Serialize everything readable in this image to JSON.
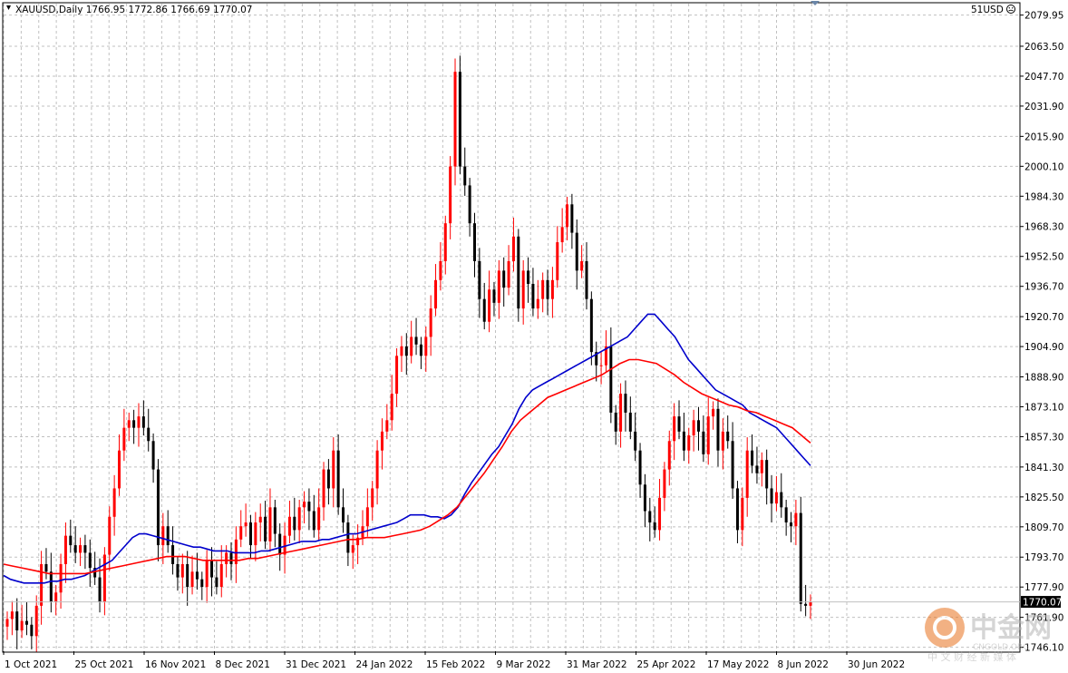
{
  "header": {
    "symbol_info": "XAUUSD,Daily  1766.95 1772.86 1766.69 1770.07",
    "account_label": "51USD"
  },
  "price_marker": {
    "value": "1770.07",
    "color": "#000000"
  },
  "watermark": {
    "brand": "中金网",
    "domain": "CNGOLD.ORG",
    "tagline": "中 文 财 经 新 媒 体"
  },
  "colors": {
    "bull": "#ff0000",
    "bear": "#000000",
    "ma_fast": "#0000cc",
    "ma_slow": "#ff0000",
    "grid": "#c0c0c0"
  },
  "chart_data": {
    "type": "candlestick",
    "title": "XAUUSD,Daily",
    "y_axis": {
      "range": [
        1744,
        2086
      ],
      "ticks": [
        "2079.95",
        "2063.50",
        "2047.70",
        "2031.90",
        "2015.90",
        "2000.10",
        "1984.30",
        "1968.30",
        "1952.50",
        "1936.70",
        "1920.70",
        "1904.90",
        "1888.90",
        "1873.10",
        "1857.30",
        "1841.30",
        "1825.50",
        "1809.70",
        "1793.70",
        "1777.90",
        "1761.90",
        "1746.10"
      ]
    },
    "x_axis": {
      "ticks": [
        "1 Oct 2021",
        "25 Oct 2021",
        "16 Nov 2021",
        "8 Dec 2021",
        "31 Dec 2021",
        "24 Jan 2022",
        "15 Feb 2022",
        "9 Mar 2022",
        "31 Mar 2022",
        "25 Apr 2022",
        "17 May 2022",
        "8 Jun 2022",
        "30 Jun 2022"
      ]
    },
    "grid": true,
    "last_price": 1770.07,
    "closes": [
      1761,
      1765,
      1755,
      1760,
      1758,
      1752,
      1768,
      1790,
      1786,
      1770,
      1775,
      1790,
      1805,
      1800,
      1796,
      1800,
      1796,
      1788,
      1783,
      1770,
      1795,
      1815,
      1830,
      1850,
      1862,
      1866,
      1862,
      1868,
      1862,
      1855,
      1840,
      1800,
      1810,
      1800,
      1790,
      1783,
      1790,
      1778,
      1786,
      1782,
      1778,
      1792,
      1783,
      1778,
      1790,
      1796,
      1790,
      1803,
      1810,
      1812,
      1800,
      1812,
      1815,
      1802,
      1820,
      1806,
      1795,
      1805,
      1815,
      1808,
      1820,
      1823,
      1818,
      1808,
      1820,
      1840,
      1830,
      1850,
      1820,
      1812,
      1796,
      1800,
      1804,
      1810,
      1820,
      1830,
      1850,
      1860,
      1866,
      1880,
      1900,
      1905,
      1900,
      1910,
      1906,
      1900,
      1910,
      1925,
      1940,
      1950,
      1970,
      2000,
      2050,
      2000,
      1990,
      1970,
      1950,
      1930,
      1918,
      1935,
      1928,
      1945,
      1936,
      1950,
      1963,
      1925,
      1945,
      1938,
      1925,
      1930,
      1940,
      1930,
      1940,
      1960,
      1968,
      1980,
      1965,
      1945,
      1950,
      1930,
      1902,
      1895,
      1895,
      1905,
      1870,
      1860,
      1880,
      1870,
      1860,
      1850,
      1832,
      1818,
      1812,
      1808,
      1825,
      1840,
      1855,
      1868,
      1860,
      1850,
      1858,
      1866,
      1860,
      1848,
      1868,
      1872,
      1850,
      1860,
      1855,
      1830,
      1808,
      1825,
      1850,
      1842,
      1838,
      1845,
      1830,
      1822,
      1828,
      1820,
      1812,
      1810,
      1817,
      1769,
      1768,
      1770
    ],
    "series": [
      {
        "name": "MA fast",
        "values": [
          1784,
          1782,
          1781,
          1780,
          1780,
          1780,
          1780,
          1781,
          1781,
          1782,
          1782,
          1783,
          1784,
          1786,
          1788,
          1790,
          1792,
          1796,
          1800,
          1804,
          1806,
          1806,
          1805,
          1804,
          1803,
          1802,
          1801,
          1800,
          1799,
          1799,
          1798,
          1797,
          1797,
          1797,
          1796,
          1796,
          1796,
          1796,
          1797,
          1797,
          1798,
          1799,
          1800,
          1801,
          1802,
          1802,
          1802,
          1803,
          1803,
          1804,
          1805,
          1806,
          1806,
          1807,
          1808,
          1809,
          1810,
          1811,
          1812,
          1814,
          1816,
          1816,
          1816,
          1815,
          1815,
          1814,
          1816,
          1820,
          1827,
          1833,
          1838,
          1843,
          1848,
          1852,
          1858,
          1864,
          1872,
          1878,
          1882,
          1884,
          1886,
          1888,
          1890,
          1892,
          1894,
          1896,
          1898,
          1900,
          1902,
          1904,
          1906,
          1908,
          1910,
          1914,
          1918,
          1922,
          1922,
          1918,
          1914,
          1910,
          1904,
          1898,
          1894,
          1890,
          1886,
          1882,
          1880,
          1878,
          1876,
          1874,
          1870,
          1868,
          1866,
          1864,
          1862,
          1858,
          1854,
          1850,
          1846,
          1842
        ]
      },
      {
        "name": "MA slow",
        "values": [
          1790,
          1789,
          1788,
          1787,
          1786,
          1785,
          1785,
          1785,
          1785,
          1785,
          1786,
          1787,
          1788,
          1789,
          1790,
          1791,
          1792,
          1793,
          1794,
          1794,
          1794,
          1793,
          1792,
          1792,
          1792,
          1792,
          1792,
          1793,
          1793,
          1794,
          1795,
          1796,
          1797,
          1798,
          1799,
          1800,
          1801,
          1802,
          1803,
          1803,
          1804,
          1804,
          1804,
          1805,
          1806,
          1807,
          1808,
          1810,
          1813,
          1816,
          1820,
          1826,
          1832,
          1838,
          1845,
          1852,
          1860,
          1866,
          1870,
          1874,
          1878,
          1880,
          1882,
          1884,
          1886,
          1888,
          1890,
          1893,
          1896,
          1898,
          1898,
          1897,
          1896,
          1893,
          1890,
          1886,
          1883,
          1880,
          1878,
          1876,
          1874,
          1873,
          1871,
          1870,
          1868,
          1866,
          1864,
          1862,
          1858,
          1854
        ]
      }
    ]
  }
}
